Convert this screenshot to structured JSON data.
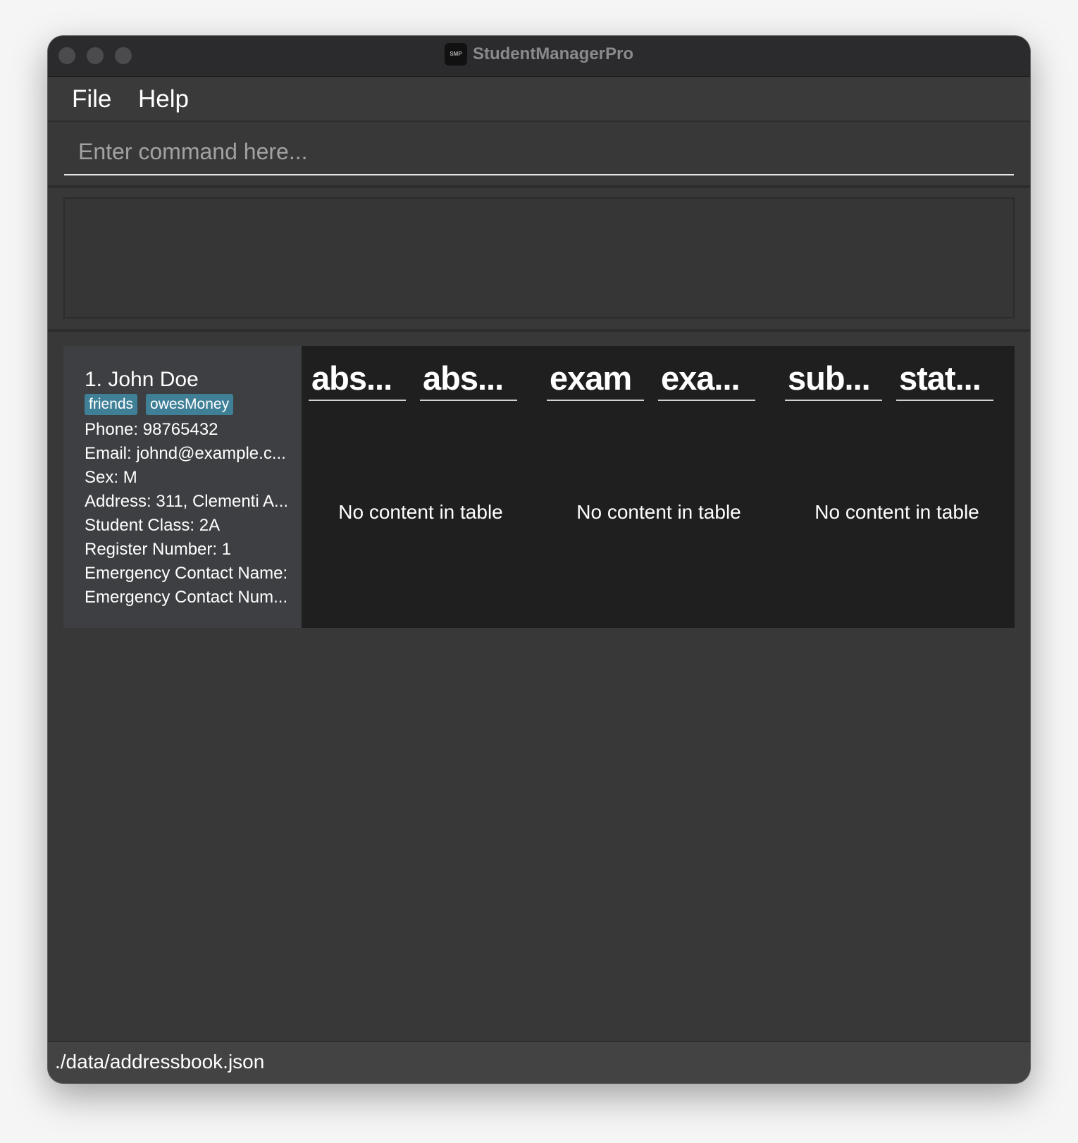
{
  "window": {
    "title": "StudentManagerPro",
    "icon_label": "SMP"
  },
  "menu": {
    "file": "File",
    "help": "Help"
  },
  "command": {
    "placeholder": "Enter command here...",
    "value": ""
  },
  "result": {
    "text": ""
  },
  "persons": [
    {
      "name": "1. John Doe",
      "tags": [
        "friends",
        "owesMoney"
      ],
      "phone": "Phone: 98765432",
      "email": "Email: johnd@example.c...",
      "sex": "Sex: M",
      "address": "Address: 311, Clementi A...",
      "student_class": "Student Class: 2A",
      "register_number": "Register Number: 1",
      "emergency_name": "Emergency Contact Name:",
      "emergency_number": "Emergency Contact Num...",
      "tables": [
        {
          "headers": [
            "abs...",
            "abs..."
          ],
          "empty": "No content in table"
        },
        {
          "headers": [
            "exam",
            "exa..."
          ],
          "empty": "No content in table"
        },
        {
          "headers": [
            "sub...",
            "stat..."
          ],
          "empty": "No content in table"
        }
      ]
    }
  ],
  "status": {
    "path": "./data/addressbook.json"
  },
  "colors": {
    "window_bg": "#383838",
    "titlebar_bg": "#2b2b2d",
    "card_bg": "#3e3f42",
    "table_bg": "#1f1f1f",
    "tag_bg": "#3f8097",
    "statusbar_bg": "#434343"
  }
}
